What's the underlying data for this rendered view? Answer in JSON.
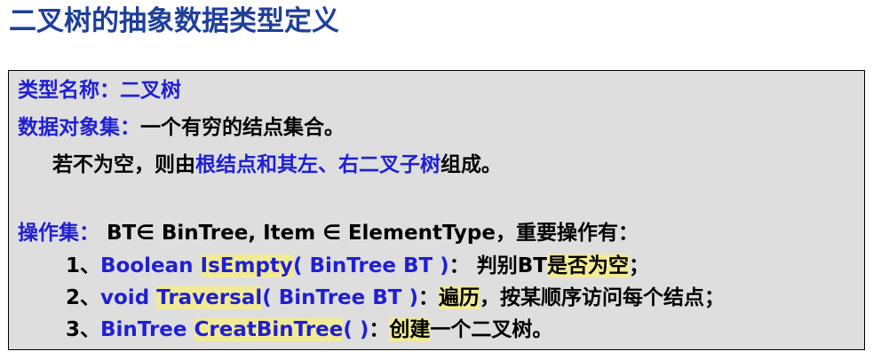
{
  "title": "二叉树的抽象数据类型定义",
  "type_name": {
    "label": "类型名称：",
    "value": "二叉树"
  },
  "data_objects": {
    "label": "数据对象集：",
    "value": "一个有穷的结点集合。",
    "line2_prefix": "若不为空，则由",
    "line2_blue": "根结点和其左、右二叉子树",
    "line2_suffix": "组成。"
  },
  "operations": {
    "label": "操作集：",
    "signature": " BT∈ BinTree, Item ∈ ElementType，重要操作有：",
    "items": [
      {
        "num": "1、",
        "type": "Boolean ",
        "name": "IsEmpty",
        "params": "( BinTree BT )",
        "sep": "： 判别BT",
        "desc_hl": "是否为空",
        "desc_tail": "；"
      },
      {
        "num": "2、",
        "type": "void ",
        "name": "Traversal",
        "params": "( BinTree BT )",
        "sep": "：",
        "desc_hl": "遍历",
        "desc_tail": "，按某顺序访问每个结点；"
      },
      {
        "num": "3、",
        "type": "BinTree ",
        "name": "CreatBinTree",
        "params": "( )",
        "sep": "：",
        "desc_hl": "创建",
        "desc_tail": "一个二叉树。"
      }
    ]
  },
  "colors": {
    "title": "#1f3f9b",
    "keyword_blue": "#1f1fd6",
    "highlight": "#f2eb96",
    "box_bg": "#dedede"
  }
}
